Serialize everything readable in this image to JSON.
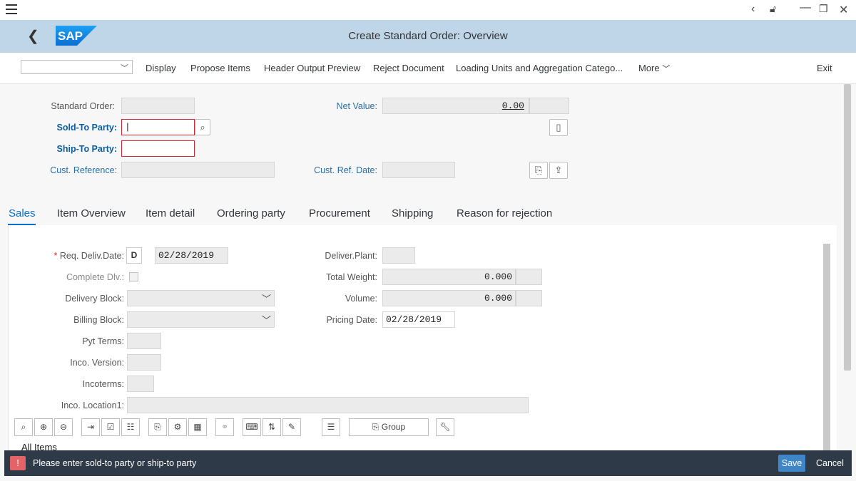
{
  "window": {
    "title": "Create Standard Order: Overview",
    "logo_text": "SAP"
  },
  "toolbar": {
    "items": [
      "Display",
      "Propose Items",
      "Header Output Preview",
      "Reject Document",
      "Loading Units and Aggregation Catego...",
      "More"
    ],
    "exit_label": "Exit"
  },
  "header": {
    "standard_order_label": "Standard Order:",
    "standard_order_value": "",
    "net_value_label": "Net Value:",
    "net_value": "0.00",
    "sold_to_label": "Sold-To Party:",
    "sold_to_value": "|",
    "ship_to_label": "Ship-To Party:",
    "ship_to_value": "",
    "cust_ref_label": "Cust. Reference:",
    "cust_ref_date_label": "Cust. Ref. Date:"
  },
  "tabs": [
    "Sales",
    "Item Overview",
    "Item detail",
    "Ordering party",
    "Procurement",
    "Shipping",
    "Reason for rejection"
  ],
  "sales": {
    "req_deliv_label": "Req. Deliv.Date:",
    "req_deliv_required": "*",
    "req_deliv_format": "D",
    "req_deliv_value": "02/28/2019",
    "complete_dlv_label": "Complete Dlv.:",
    "delivery_block_label": "Delivery Block:",
    "billing_block_label": "Billing Block:",
    "pyt_terms_label": "Pyt Terms:",
    "inco_version_label": "Inco. Version:",
    "incoterms_label": "Incoterms:",
    "inco_location_label": "Inco. Location1:",
    "deliver_plant_label": "Deliver.Plant:",
    "total_weight_label": "Total Weight:",
    "total_weight_value": "0.000",
    "volume_label": "Volume:",
    "volume_value": "0.000",
    "pricing_date_label": "Pricing Date:",
    "pricing_date_value": "02/28/2019"
  },
  "item_toolbar": {
    "group_label": "Group",
    "all_items_label": "All Items"
  },
  "message": {
    "text": "Please enter sold-to party or ship-to party",
    "save_label": "Save",
    "cancel_label": "Cancel"
  }
}
